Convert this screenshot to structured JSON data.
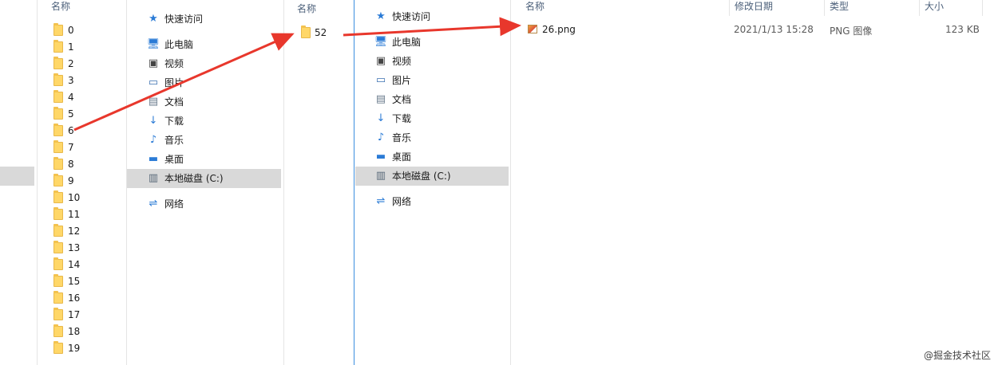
{
  "panel1": {
    "header": "名称",
    "folders": [
      "0",
      "1",
      "2",
      "3",
      "4",
      "5",
      "6",
      "7",
      "8",
      "9",
      "10",
      "11",
      "12",
      "13",
      "14",
      "15",
      "16",
      "17",
      "18",
      "19"
    ]
  },
  "nav_a": {
    "items": [
      {
        "label": "快速访问",
        "icon": "star-icon"
      },
      {
        "label": "此电脑",
        "icon": "computer-icon"
      },
      {
        "label": "视频",
        "icon": "video-icon"
      },
      {
        "label": "图片",
        "icon": "picture-icon"
      },
      {
        "label": "文档",
        "icon": "document-icon"
      },
      {
        "label": "下载",
        "icon": "download-icon"
      },
      {
        "label": "音乐",
        "icon": "music-icon"
      },
      {
        "label": "桌面",
        "icon": "desktop-icon"
      },
      {
        "label": "本地磁盘 (C:)",
        "icon": "drive-icon"
      },
      {
        "label": "网络",
        "icon": "network-icon"
      }
    ]
  },
  "panel2": {
    "header": "名称",
    "folder": "52"
  },
  "nav_b": {
    "items": [
      {
        "label": "快速访问",
        "icon": "star-icon"
      },
      {
        "label": "此电脑",
        "icon": "computer-icon"
      },
      {
        "label": "视频",
        "icon": "video-icon"
      },
      {
        "label": "图片",
        "icon": "picture-icon"
      },
      {
        "label": "文档",
        "icon": "document-icon"
      },
      {
        "label": "下载",
        "icon": "download-icon"
      },
      {
        "label": "音乐",
        "icon": "music-icon"
      },
      {
        "label": "桌面",
        "icon": "desktop-icon"
      },
      {
        "label": "本地磁盘 (C:)",
        "icon": "drive-icon"
      },
      {
        "label": "网络",
        "icon": "network-icon"
      }
    ]
  },
  "panel3": {
    "headers": {
      "name": "名称",
      "modified": "修改日期",
      "type": "类型",
      "size": "大小"
    },
    "file": {
      "name": "26.png",
      "modified": "2021/1/13 15:28",
      "type": "PNG 图像",
      "size": "123 KB"
    }
  },
  "colors": {
    "annotation_arrow": "#e8372c",
    "selection": "#d9d9d9",
    "folder": "#ffd768",
    "focus_line": "#3c8ee0"
  },
  "watermark": "@掘金技术社区"
}
